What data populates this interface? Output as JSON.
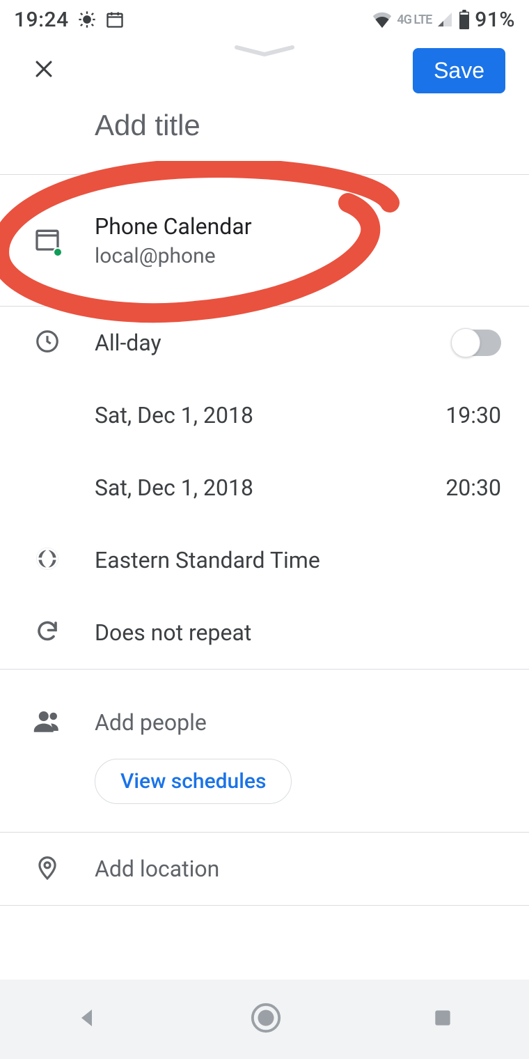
{
  "status": {
    "time": "19:24",
    "network_label": "4G LTE",
    "battery": "91%"
  },
  "header": {
    "save_label": "Save"
  },
  "title_placeholder": "Add title",
  "calendar": {
    "name": "Phone Calendar",
    "account": "local@phone"
  },
  "allday": {
    "label": "All-day",
    "on": false
  },
  "start": {
    "date": "Sat, Dec 1, 2018",
    "time": "19:30"
  },
  "end": {
    "date": "Sat, Dec 1, 2018",
    "time": "20:30"
  },
  "timezone": "Eastern Standard Time",
  "repeat": "Does not repeat",
  "people": {
    "placeholder": "Add people",
    "view_schedules": "View schedules"
  },
  "location_placeholder": "Add location"
}
